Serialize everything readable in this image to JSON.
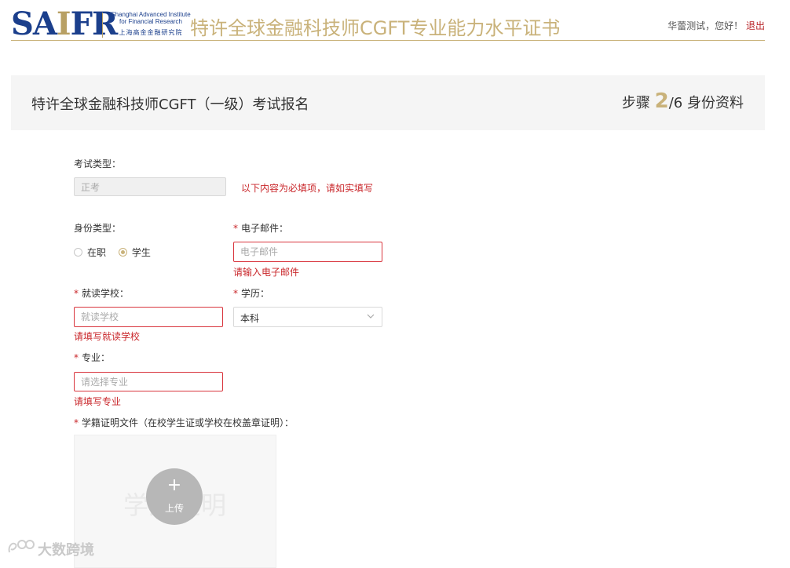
{
  "header": {
    "logo_mark_blue_1": "SA",
    "logo_mark_gold": "I",
    "logo_mark_blue_2": "FR",
    "logo_en_line1": "Shanghai Advanced Institute",
    "logo_en_line2": "for Financial Research",
    "logo_cn": "上海高金金融研究院",
    "site_title": "特许全球金融科技师CGFT专业能力水平证书",
    "greeting": "华蕾测试，您好！",
    "logout": "退出"
  },
  "banner": {
    "title": "特许全球金融科技师CGFT（一级）考试报名",
    "step_prefix": "步骤",
    "step_current": "2",
    "step_total": "/6",
    "step_name": "身份资料"
  },
  "form": {
    "exam_type_label": "考试类型：",
    "exam_type_value": "正考",
    "required_note": "以下内容为必填项，请如实填写",
    "identity_label": "身份类型：",
    "identity_options": [
      "在职",
      "学生"
    ],
    "identity_selected": "学生",
    "email_label": "电子邮件：",
    "email_placeholder": "电子邮件",
    "email_error": "请输入电子邮件",
    "school_label": "就读学校：",
    "school_placeholder": "就读学校",
    "school_error": "请填写就读学校",
    "education_label": "学历：",
    "education_value": "本科",
    "major_label": "专业：",
    "major_placeholder": "请选择专业",
    "major_error": "请填写专业",
    "upload_label": "学籍证明文件（在校学生证或学校在校盖章证明）：",
    "upload_watermark": "学历证明",
    "upload_plus": "+",
    "upload_button": "上传"
  },
  "watermark": {
    "text": "大数跨境"
  },
  "colors": {
    "brand_blue": "#1b3f8c",
    "gold": "#c9b27a",
    "error_red": "#c9262a"
  }
}
